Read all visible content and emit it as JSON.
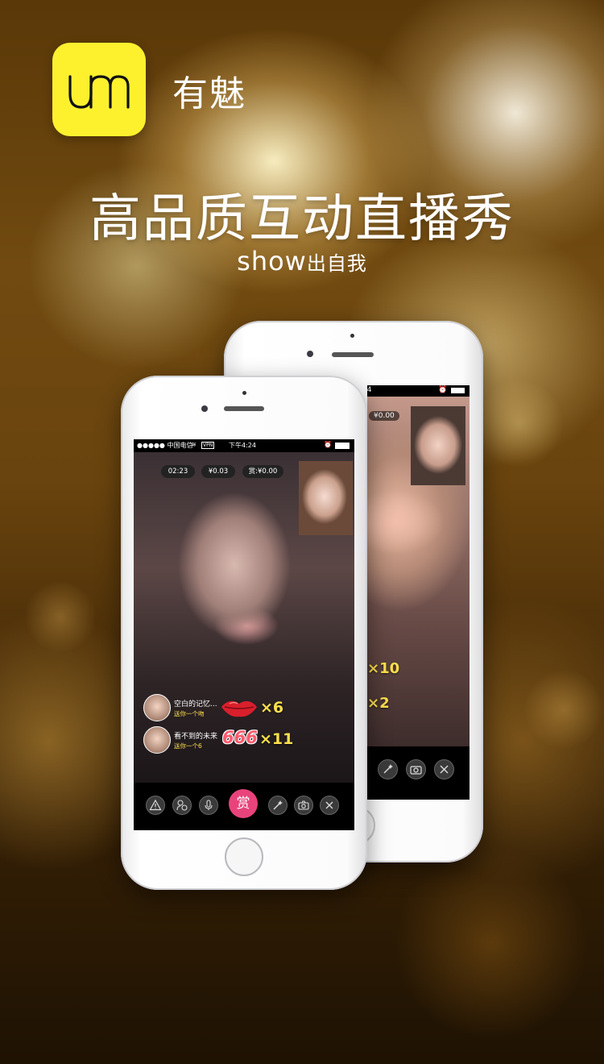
{
  "app": {
    "logo_text": "um",
    "name": "有魅",
    "headline": "高品质互动直播秀",
    "tagline_latin": "show",
    "tagline_cn": "出自我",
    "brand_color": "#fdf12e"
  },
  "front_phone": {
    "status_bar": {
      "carrier": "●●●●● 中国电信",
      "network": "VPN",
      "time": "下午4:24"
    },
    "stats": {
      "timer": "02:23",
      "earnings": "¥0.03",
      "reward": "赏:¥0.00"
    },
    "gifts": [
      {
        "user": "空白的记忆...",
        "desc": "送你一个吻",
        "count": "×6",
        "gift_icon": "lips-icon"
      },
      {
        "user": "看不到的未来",
        "desc": "送你一个6",
        "count": "×11",
        "gift_icon": "666-icon",
        "gift_text": "666"
      }
    ],
    "toolbar": {
      "reward_label": "赏",
      "reward_color": "#e9437b",
      "icons": [
        "warning-icon",
        "filter-icon",
        "microphone-icon",
        "magic-wand-icon",
        "camera-switch-icon",
        "close-icon"
      ]
    }
  },
  "back_phone": {
    "status_bar": {
      "time": "24"
    },
    "stats": {
      "earnings": "¥0.00"
    },
    "gift_counts": [
      "×10",
      "×2"
    ],
    "toolbar_icons": [
      "magic-wand-icon",
      "camera-switch-icon",
      "close-icon"
    ]
  },
  "colors": {
    "gift_count": "#fde04c",
    "background": "#5a3808"
  }
}
